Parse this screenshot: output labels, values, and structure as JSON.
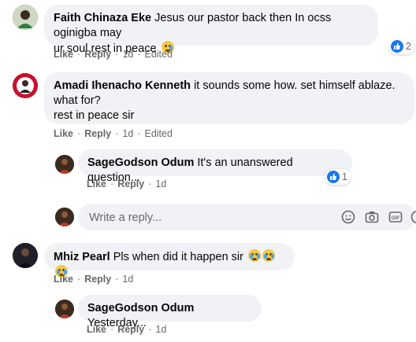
{
  "comments": [
    {
      "author": "Faith Chinaza Eke",
      "text": "Jesus our pastor back then In ocss oginigba may",
      "text_line2": "ur soul rest in peace",
      "actions": {
        "like": "Like",
        "reply": "Reply",
        "time": "1d",
        "edited": "Edited"
      },
      "reaction_count": "2"
    },
    {
      "author": "Amadi Ihenacho Kenneth",
      "text": "it sounds some how. set himself ablaze.",
      "text_line2": "what for?",
      "text_line3": "rest in peace sir",
      "actions": {
        "like": "Like",
        "reply": "Reply",
        "time": "1d",
        "edited": "Edited"
      },
      "reply": {
        "author": "SageGodson Odum",
        "text": "It's an unanswered question...",
        "actions": {
          "like": "Like",
          "reply": "Reply",
          "time": "1d"
        },
        "reaction_count": "1"
      }
    },
    {
      "author": "Mhiz Pearl",
      "text": "Pls when did it happen sir",
      "actions": {
        "like": "Like",
        "reply": "Reply",
        "time": "1d"
      },
      "reply": {
        "author": "SageGodson Odum",
        "text": "Yesterday...",
        "actions": {
          "like": "Like",
          "reply": "Reply",
          "time": "1d"
        }
      }
    }
  ],
  "reply_box": {
    "placeholder": "Write a reply..."
  },
  "colors": {
    "bubble": "#f0f2f5",
    "like_blue": "#1877f2",
    "meta": "#65676b"
  }
}
